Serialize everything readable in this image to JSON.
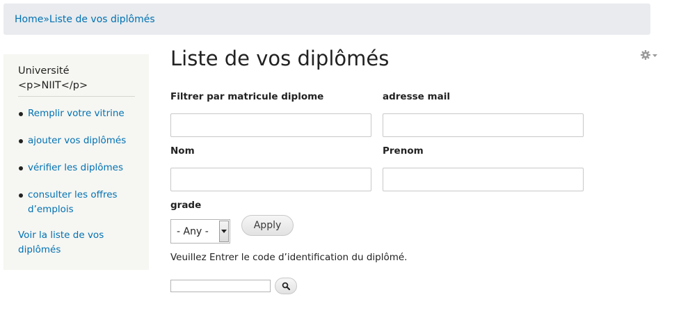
{
  "breadcrumb": {
    "home": "Home",
    "separator": "»",
    "current": "Liste de vos diplômés"
  },
  "sidebar": {
    "title_line1": "Université",
    "title_line2": "<p>NIIT</p>",
    "items": [
      {
        "label": "Remplir votre vitrine"
      },
      {
        "label": "ajouter vos diplômés"
      },
      {
        "label": "vérifier les diplômes"
      },
      {
        "label": "consulter les offres d’emplois"
      }
    ],
    "plain_link": "Voir la liste de vos diplômés"
  },
  "main": {
    "title": "Liste de vos diplômés",
    "gear_icon": "gear-icon",
    "filters": {
      "matricule_label": "Filtrer par matricule diplome",
      "matricule_value": "",
      "email_label": "adresse mail",
      "email_value": "",
      "nom_label": "Nom",
      "nom_value": "",
      "prenom_label": "Prenom",
      "prenom_value": "",
      "grade_label": "grade",
      "grade_selected": "- Any -",
      "apply_label": "Apply"
    },
    "help_text": "Veuillez Entrer le code d’identification du diplômé.",
    "code_value": "",
    "search_icon": "search-icon"
  },
  "colors": {
    "link": "#0071b3",
    "breadcrumb_bg": "#e9ebee",
    "sidebar_bg": "#f6f6f2"
  }
}
